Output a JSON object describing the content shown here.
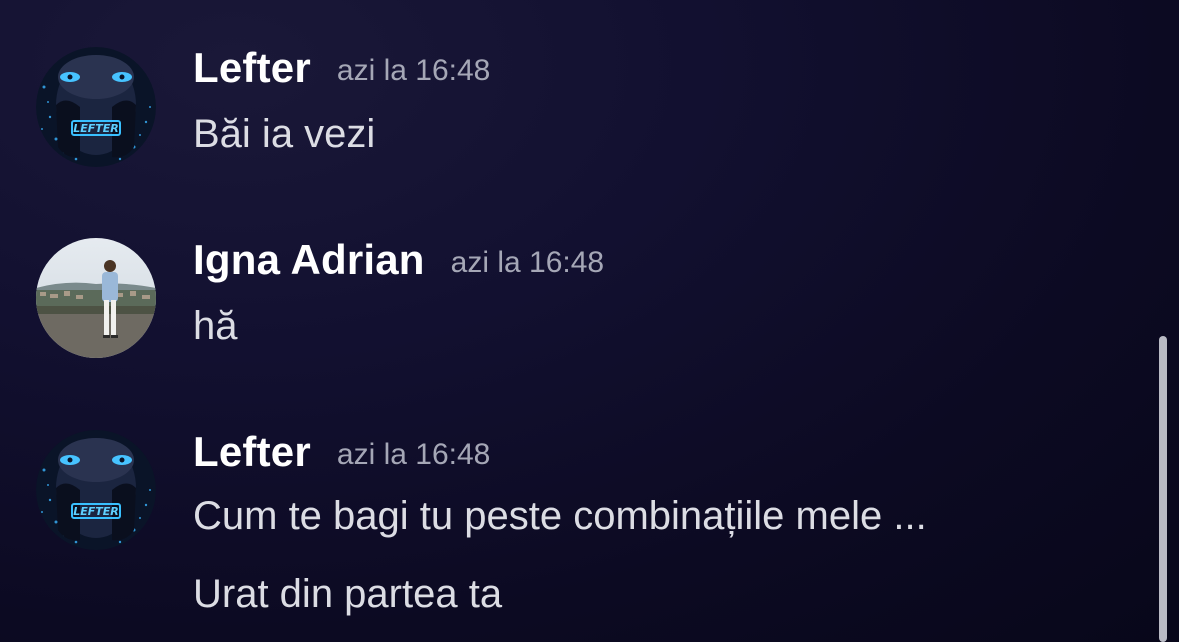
{
  "messages": [
    {
      "author": "Lefter",
      "timestamp": "azi la 16:48",
      "lines": [
        "Băi ia vezi"
      ],
      "avatar_icon": "masked-face-avatar",
      "avatar_text": "LEFTER"
    },
    {
      "author": "Igna Adrian",
      "timestamp": "azi la 16:48",
      "lines": [
        "hă"
      ],
      "avatar_icon": "person-photo-avatar"
    },
    {
      "author": "Lefter",
      "timestamp": "azi la 16:48",
      "lines": [
        "Cum te bagi tu peste combinațiile mele ...",
        "Urat din partea ta"
      ],
      "avatar_icon": "masked-face-avatar",
      "avatar_text": "LEFTER"
    }
  ],
  "colors": {
    "background": "#0c0a22",
    "username": "#ffffff",
    "timestamp": "#a5a7b6",
    "message_text": "#dcdde4",
    "scrollbar": "#b9bac4",
    "avatar_glow": "#2fa8ff"
  }
}
